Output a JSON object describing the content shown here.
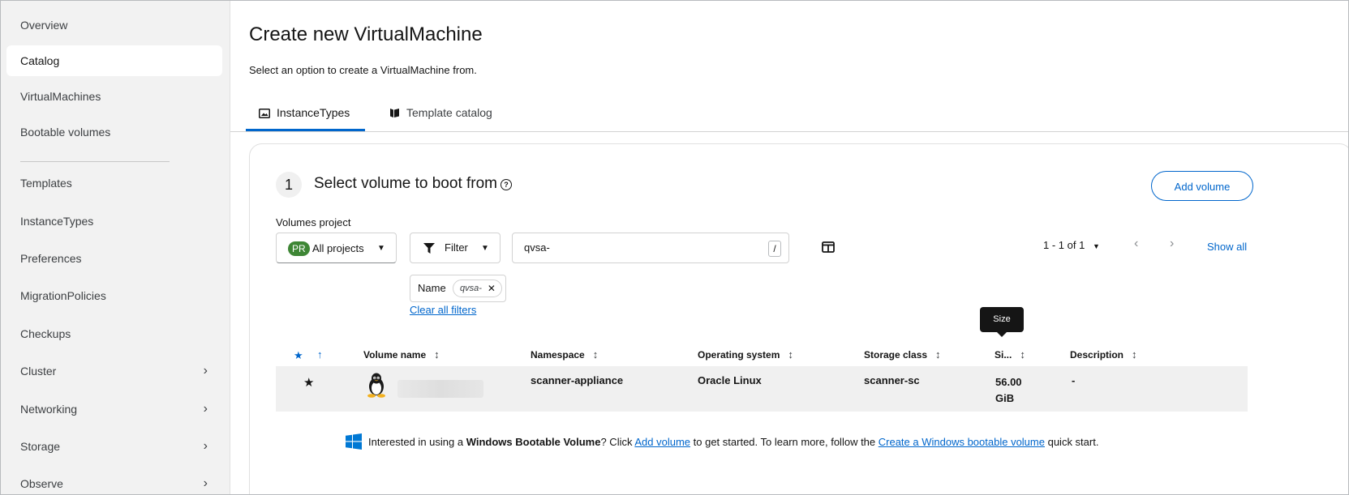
{
  "sidebar": {
    "items": [
      {
        "label": "Overview"
      },
      {
        "label": "Catalog",
        "active": true
      },
      {
        "label": "VirtualMachines"
      },
      {
        "label": "Bootable volumes"
      },
      {
        "label": "Templates"
      },
      {
        "label": "InstanceTypes"
      },
      {
        "label": "Preferences"
      },
      {
        "label": "MigrationPolicies"
      },
      {
        "label": "Checkups"
      },
      {
        "label": "Cluster",
        "expandable": true
      },
      {
        "label": "Networking",
        "expandable": true
      },
      {
        "label": "Storage",
        "expandable": true
      },
      {
        "label": "Observe",
        "expandable": true
      }
    ]
  },
  "header": {
    "title": "Create new VirtualMachine",
    "subtitle": "Select an option to create a VirtualMachine from."
  },
  "tabs": [
    {
      "label": "InstanceTypes",
      "icon": "image-icon",
      "active": true
    },
    {
      "label": "Template catalog",
      "icon": "catalog-icon"
    }
  ],
  "step": {
    "number": "1",
    "title": "Select volume to boot from",
    "add_volume_label": "Add volume"
  },
  "toolbar": {
    "project_label": "Volumes project",
    "project_badge": "PR",
    "project_value": "All projects",
    "filter_label": "Filter",
    "search_value": "qvsa-",
    "search_shortcut": "/",
    "pagination": "1 - 1 of 1",
    "show_all": "Show all"
  },
  "filters": {
    "category": "Name",
    "chip": "qvsa-",
    "clear_all": "Clear all filters"
  },
  "tooltip": "Size",
  "table": {
    "columns": [
      "Volume name",
      "Namespace",
      "Operating system",
      "Storage class",
      "Si...",
      "Description"
    ],
    "rows": [
      {
        "favorite": true,
        "os_icon": "linux-tux-icon",
        "volume_name_prefix": "",
        "namespace": "scanner-appliance",
        "operating_system": "Oracle Linux",
        "storage_class": "scanner-sc",
        "size_line1": "56.00",
        "size_line2": "GiB",
        "description": "-"
      }
    ]
  },
  "windows_note": {
    "prefix": "Interested in using a ",
    "bold": "Windows Bootable Volume",
    "mid1": "? Click ",
    "link1": "Add volume",
    "mid2": " to get started. To learn more, follow the ",
    "link2": "Create a Windows bootable volume",
    "suffix": " quick start."
  },
  "colors": {
    "accent": "#0066cc",
    "project_badge": "#3e8635",
    "sidebar_bg": "#f2f2f2"
  }
}
